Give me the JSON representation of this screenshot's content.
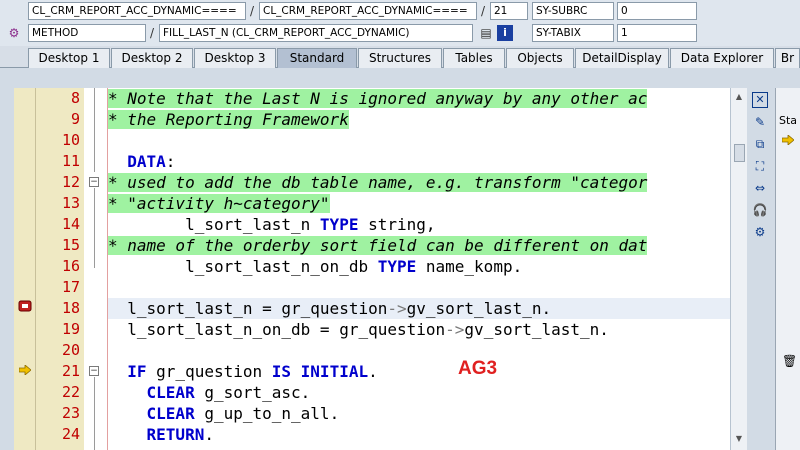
{
  "info": {
    "row1": {
      "class_name": "CL_CRM_REPORT_ACC_DYNAMIC====",
      "include_name": "CL_CRM_REPORT_ACC_DYNAMIC====",
      "line": "21",
      "field_label": "SY-SUBRC",
      "field_value": "0"
    },
    "row2": {
      "type": "METHOD",
      "event": "FILL_LAST_N (CL_CRM_REPORT_ACC_DYNAMIC)",
      "field_label": "SY-TABIX",
      "field_value": "1"
    }
  },
  "tabs": [
    {
      "label": "Desktop 1"
    },
    {
      "label": "Desktop 2"
    },
    {
      "label": "Desktop 3"
    },
    {
      "label": "Standard"
    },
    {
      "label": "Structures"
    },
    {
      "label": "Tables"
    },
    {
      "label": "Objects"
    },
    {
      "label": "DetailDisplay"
    },
    {
      "label": "Data Explorer"
    },
    {
      "label": "Br"
    }
  ],
  "active_tab": "Standard",
  "side_panel": {
    "label": "Sta"
  },
  "annotation": "AG3",
  "code": {
    "lines": [
      {
        "num": "8",
        "parts": [
          {
            "t": "* Note that the Last N is ignored anyway by any other ac",
            "c": ""
          }
        ]
      },
      {
        "num": "9",
        "parts": [
          {
            "t": "* the Reporting Framework",
            "c": ""
          }
        ]
      },
      {
        "num": "10",
        "parts": []
      },
      {
        "num": "11",
        "parts": [
          {
            "t": "  ",
            "c": ""
          },
          {
            "t": "DATA",
            "c": "kw"
          },
          {
            "t": ":",
            "c": ""
          }
        ]
      },
      {
        "num": "12",
        "parts": [
          {
            "t": "* used to add the db table name, e.g. transform \"categor",
            "c": ""
          }
        ]
      },
      {
        "num": "13",
        "parts": [
          {
            "t": "* \"activity h~category\"",
            "c": ""
          }
        ]
      },
      {
        "num": "14",
        "parts": [
          {
            "t": "        l_sort_last_n ",
            "c": ""
          },
          {
            "t": "TYPE",
            "c": "kw"
          },
          {
            "t": " string,",
            "c": ""
          }
        ]
      },
      {
        "num": "15",
        "parts": [
          {
            "t": "* name of the orderby sort field can be different on dat",
            "c": ""
          }
        ]
      },
      {
        "num": "16",
        "parts": [
          {
            "t": "        l_sort_last_n_on_db ",
            "c": ""
          },
          {
            "t": "TYPE",
            "c": "kw"
          },
          {
            "t": " name_komp.",
            "c": ""
          }
        ]
      },
      {
        "num": "17",
        "parts": []
      },
      {
        "num": "18",
        "parts": [
          {
            "t": "  l_sort_last_n = gr_question",
            "c": ""
          },
          {
            "t": "->",
            "c": "op"
          },
          {
            "t": "gv_sort_last_n.",
            "c": ""
          }
        ]
      },
      {
        "num": "19",
        "parts": [
          {
            "t": "  l_sort_last_n_on_db = gr_question",
            "c": ""
          },
          {
            "t": "->",
            "c": "op"
          },
          {
            "t": "gv_sort_last_n.",
            "c": ""
          }
        ]
      },
      {
        "num": "20",
        "parts": []
      },
      {
        "num": "21",
        "parts": [
          {
            "t": "  ",
            "c": ""
          },
          {
            "t": "IF",
            "c": "kw"
          },
          {
            "t": " gr_question ",
            "c": ""
          },
          {
            "t": "IS INITIAL",
            "c": "kw"
          },
          {
            "t": ".",
            "c": ""
          }
        ]
      },
      {
        "num": "22",
        "parts": [
          {
            "t": "    ",
            "c": ""
          },
          {
            "t": "CLEAR",
            "c": "kw"
          },
          {
            "t": " g_sort_asc.",
            "c": ""
          }
        ]
      },
      {
        "num": "23",
        "parts": [
          {
            "t": "    ",
            "c": ""
          },
          {
            "t": "CLEAR",
            "c": "kw"
          },
          {
            "t": " g_up_to_n_all.",
            "c": ""
          }
        ]
      },
      {
        "num": "24",
        "parts": [
          {
            "t": "    ",
            "c": ""
          },
          {
            "t": "RETURN",
            "c": "kw"
          },
          {
            "t": ".",
            "c": ""
          }
        ]
      }
    ]
  },
  "icons": {
    "method_icon": "method-icon",
    "breakpoint_icon": "breakpoint-stop-icon",
    "current_line_icon": "current-line-arrow-icon"
  }
}
